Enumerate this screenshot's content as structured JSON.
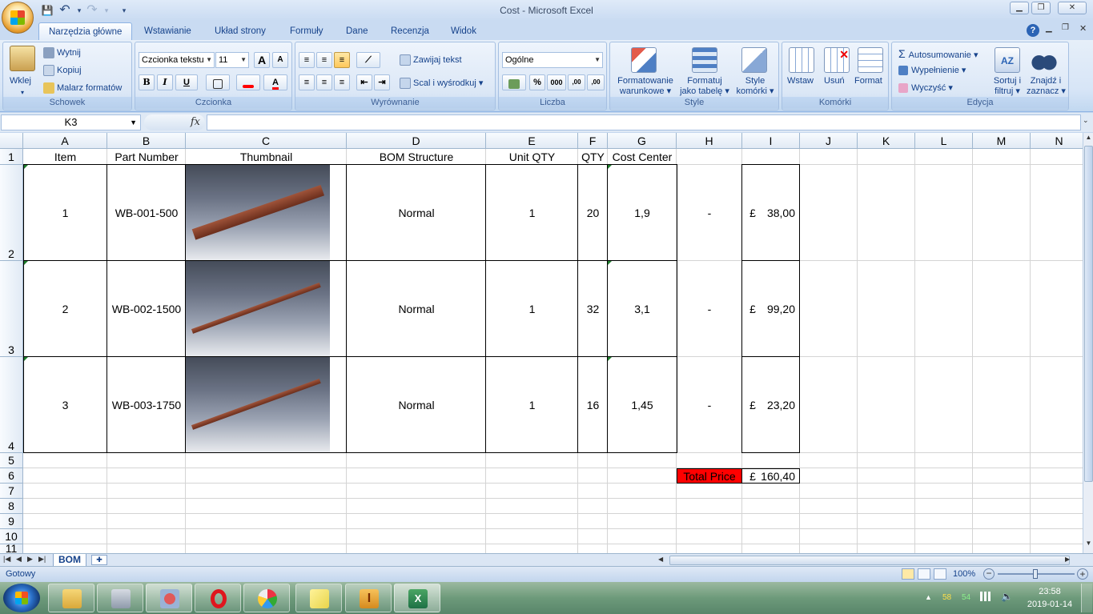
{
  "window": {
    "title": "Cost - Microsoft Excel"
  },
  "qat": {
    "save": "💾",
    "undo": "↶",
    "redo": "↷",
    "more": "▾"
  },
  "tabs": [
    "Narzędzia główne",
    "Wstawianie",
    "Układ strony",
    "Formuły",
    "Dane",
    "Recenzja",
    "Widok"
  ],
  "ribbon": {
    "clipboard": {
      "label": "Schowek",
      "paste": "Wklej",
      "cut": "Wytnij",
      "copy": "Kopiuj",
      "format_painter": "Malarz formatów"
    },
    "font": {
      "label": "Czcionka",
      "name": "Czcionka tekstu",
      "size": "11",
      "bold": "B",
      "italic": "I",
      "underline": "U",
      "grow": "A",
      "shrink": "A"
    },
    "alignment": {
      "label": "Wyrównanie",
      "wrap": "Zawijaj tekst",
      "merge": "Scal i wyśrodkuj"
    },
    "number": {
      "label": "Liczba",
      "format": "Ogólne",
      "percent": "%",
      "thousands": "000",
      "inc_dec": ",00",
      "dec_dec": ",00"
    },
    "styles": {
      "label": "Style",
      "conditional": "Formatowanie",
      "conditional2": "warunkowe",
      "as_table": "Formatuj",
      "as_table2": "jako tabelę",
      "cell_styles": "Style",
      "cell_styles2": "komórki"
    },
    "cells": {
      "label": "Komórki",
      "insert": "Wstaw",
      "delete": "Usuń",
      "format": "Format"
    },
    "editing": {
      "label": "Edycja",
      "autosum": "Autosumowanie",
      "fill": "Wypełnienie",
      "clear": "Wyczyść",
      "sort": "Sortuj i",
      "sort2": "filtruj",
      "find": "Znajdź i",
      "find2": "zaznacz"
    }
  },
  "formula_bar": {
    "name_box": "K3",
    "fx": "fx",
    "content": ""
  },
  "columns": [
    "A",
    "B",
    "C",
    "D",
    "E",
    "F",
    "G",
    "H",
    "I",
    "J",
    "K",
    "L",
    "M",
    "N"
  ],
  "rows": [
    "1",
    "2",
    "3",
    "4",
    "5",
    "6",
    "7",
    "8",
    "9",
    "10",
    "11"
  ],
  "headers": {
    "item": "Item",
    "part": "Part Number",
    "thumb": "Thumbnail",
    "bom": "BOM Structure",
    "unit": "Unit QTY",
    "qty": "QTY",
    "cost": "Cost Center"
  },
  "bom": [
    {
      "item": "1",
      "part": "WB-001-500",
      "bom": "Normal",
      "unit": "1",
      "qty": "20",
      "cost": "1,9",
      "h": "-",
      "cur": "£",
      "price": "38,00"
    },
    {
      "item": "2",
      "part": "WB-002-1500",
      "bom": "Normal",
      "unit": "1",
      "qty": "32",
      "cost": "3,1",
      "h": "-",
      "cur": "£",
      "price": "99,20"
    },
    {
      "item": "3",
      "part": "WB-003-1750",
      "bom": "Normal",
      "unit": "1",
      "qty": "16",
      "cost": "1,45",
      "h": "-",
      "cur": "£",
      "price": "23,20"
    }
  ],
  "total": {
    "label": "Total Price",
    "cur": "£",
    "value": "160,40",
    "label_bg": "#ff0000"
  },
  "sheet_tab": "BOM",
  "status": {
    "ready": "Gotowy",
    "zoom": "100%"
  },
  "clock": {
    "time": "23:58",
    "date": "2019-01-14"
  },
  "tray": {
    "a": "58",
    "b": "54"
  }
}
